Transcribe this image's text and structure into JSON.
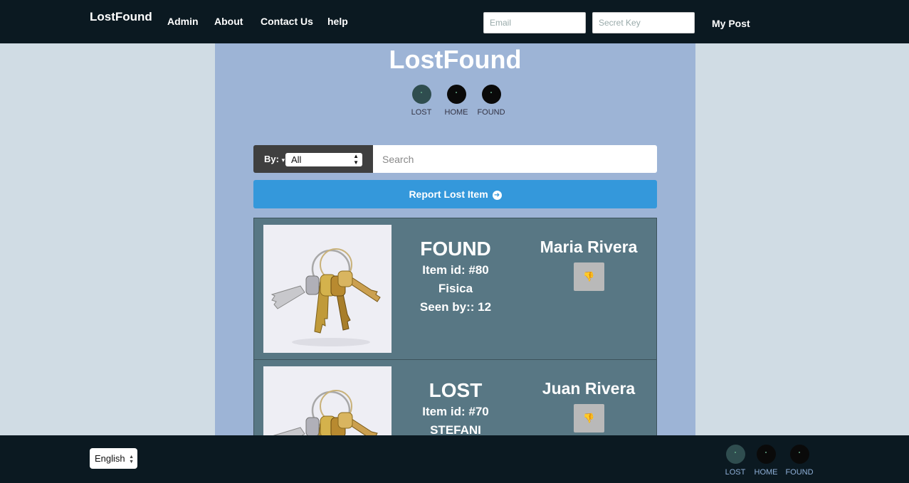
{
  "nav": {
    "brand": "LostFound",
    "links": [
      "Admin",
      "About",
      "Contact Us",
      "help"
    ],
    "email_placeholder": "Email",
    "key_placeholder": "Secret Key",
    "mypost": "My Post"
  },
  "main": {
    "title": "LostFound",
    "circles": [
      {
        "label": "LOST",
        "color": "#2f4d4f"
      },
      {
        "label": "HOME",
        "color": "#0a0a0a"
      },
      {
        "label": "FOUND",
        "color": "#0a0a0a"
      }
    ]
  },
  "search": {
    "by_label": "By:",
    "by_value": "All",
    "placeholder": "Search"
  },
  "report_button": "Report Lost Item",
  "items": [
    {
      "status": "FOUND",
      "item_id": "Item id: #80",
      "name": "Fisica",
      "seen": "Seen by:: 12",
      "owner": "Maria Rivera",
      "image": "keys-photo"
    },
    {
      "status": "LOST",
      "item_id": "Item id: #70",
      "name": "STEFANI",
      "owner": "Juan Rivera",
      "image": "keys-photo"
    }
  ],
  "footer": {
    "language": "English",
    "circles": [
      {
        "label": "LOST",
        "color": "#2f4d4f"
      },
      {
        "label": "HOME",
        "color": "#0a0a0a"
      },
      {
        "label": "FOUND",
        "color": "#0a0a0a"
      }
    ]
  }
}
